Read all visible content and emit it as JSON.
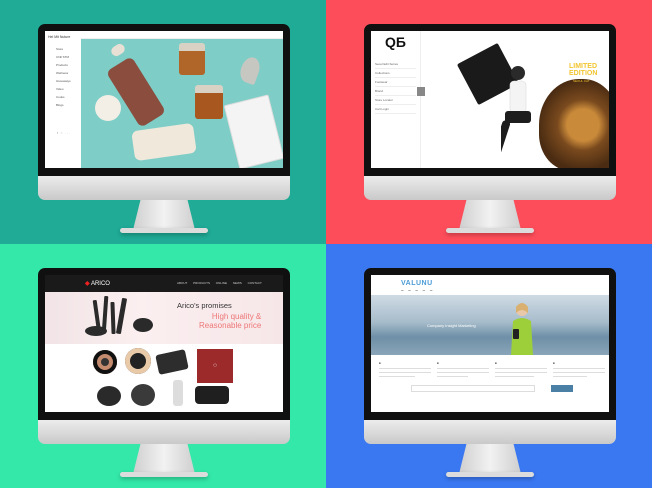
{
  "colors": {
    "tl_background": "#1fab96",
    "tr_background": "#fe4d5a",
    "bl_background": "#33e8a8",
    "br_background": "#3a78f2"
  },
  "screen1": {
    "logo": "Hel Mit Nuture",
    "nav": [
      "Store",
      "Chill STM",
      "Products",
      "Wellness",
      "Giveaways",
      "Video",
      "Cooks",
      "Blogs"
    ],
    "social": "f ○ ..."
  },
  "screen2": {
    "logo": "QБ",
    "nav": [
      "Seoul Edit Series",
      "Collections",
      "Footwear",
      "Brand",
      "Store Locator",
      "Cart Login"
    ],
    "badge_line1": "LIMITED",
    "badge_line2": "EDITION",
    "badge_sub": "SEOUL CAT"
  },
  "screen3": {
    "brand": "ARICO",
    "nav": "ABOUT PRODUCTS ONLINE NEWS CONTACT",
    "headline": "Arico's promises",
    "sub1": "High quality &",
    "sub2": "Reasonable price"
  },
  "screen4": {
    "brand": "VALUNU",
    "slogan": "Company Insight Marketing"
  }
}
